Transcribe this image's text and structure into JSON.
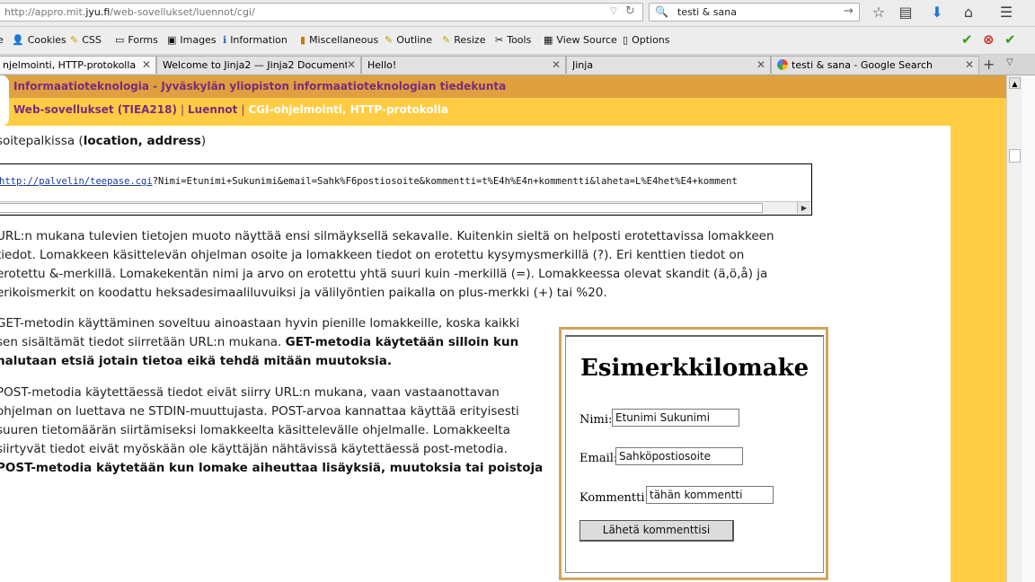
{
  "browser": {
    "url_prefix": "http://appro.mit.",
    "url_domain": "jyu.fi",
    "url_path": "/web-sovellukset/luennot/cgi/",
    "search_value": "testi & sana"
  },
  "devbar": {
    "items": [
      "Cookies",
      "CSS",
      "Forms",
      "Images",
      "Information",
      "Miscellaneous",
      "Outline",
      "Resize",
      "Tools",
      "View Source",
      "Options"
    ]
  },
  "tabs": [
    {
      "title": "njelmointi, HTTP-protokolla",
      "active": true
    },
    {
      "title": "Welcome to Jinja2 — Jinja2 Documentat...",
      "active": false
    },
    {
      "title": "Hello!",
      "active": false
    },
    {
      "title": "Jinja",
      "active": false
    },
    {
      "title": "testi & sana - Google Search",
      "active": false
    }
  ],
  "site": {
    "title": "Informaatioteknologia - Jyväskylän yliopiston informaatioteknologian tiedekunta",
    "breadcrumbs": [
      "Web-sovellukset (TIEA218)",
      "Luennot",
      "CGI-ohjelmointi, HTTP-protokolla"
    ]
  },
  "article": {
    "intro_end": "soitepalkissa (",
    "intro_bold": "location, address",
    "intro_close": ")",
    "code_link": "http://palvelin/teepase.cgi",
    "code_rest": "?Nimi=Etunimi+Sukunimi&email=Sahk%F6postiosoite&kommentti=t%E4h%E4n+kommentti&laheta=L%E4het%E4+komment",
    "para1": [
      "URL:n mukana tulevien tietojen muoto näyttää ensi silmäyksellä sekavalle. Kuitenkin sieltä on helposti erotettavissa lomakkeen",
      "tiedot. Lomakkeen käsittelevän ohjelman osoite ja lomakkeen tiedot on erotettu kysymysmerkillä (?). Eri kenttien tiedot on",
      "erotettu &-merkillä. Lomakekentän nimi ja arvo on erotettu yhtä suuri kuin -merkillä (=). Lomakkeessa olevat skandit (ä,ö,å) ja",
      "erikoismerkit on koodattu heksadesimaaliluvuiksi ja välilyöntien paikalla on plus-merkki (+) tai %20."
    ],
    "para2_line1": "GET-metodin käyttäminen soveltuu ainoastaan hyvin pienille lomakkeille, koska kaikki",
    "para2_line2_plain": "sen sisältämät tiedot siirretään URL:n mukana. ",
    "para2_line2_bold": "GET-metodia käytetään silloin kun",
    "para2_line3_bold": "halutaan etsiä jotain tietoa eikä tehdä mitään muutoksia.",
    "para3": [
      "POST-metodia käytettäessä tiedot eivät siirry URL:n mukana, vaan vastaanottavan",
      "ohjelman on luettava ne STDIN-muuttujasta. POST-arvoa kannattaa käyttää erityisesti",
      "suuren tietomäärän siirtämiseksi lomakkeelta käsittelevälle ohjelmalle. Lomakkeelta",
      "siirtyvät tiedot eivät myöskään ole käyttäjän nähtävissä käytettäessä post-metodia."
    ],
    "para3_bold": "POST-metodia käytetään kun lomake aiheuttaa lisäyksiä, muutoksia tai poistoja"
  },
  "example_form": {
    "title": "Esimerkkilomake",
    "name_label": "Nimi:",
    "name_value": "Etunimi Sukunimi",
    "email_label": "Email:",
    "email_value": "Sahköpostiosoite",
    "comment_label": "Kommentti:",
    "comment_value": "tähän kommentti",
    "submit_label": "Lähetä kommenttisi"
  }
}
